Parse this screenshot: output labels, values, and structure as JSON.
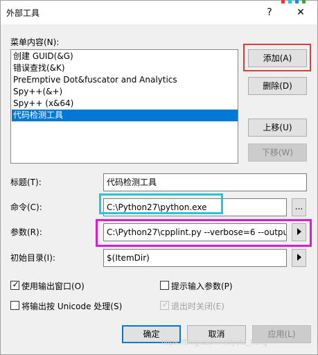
{
  "window": {
    "title": "外部工具",
    "help_glyph": "?",
    "close_glyph": "✕"
  },
  "menu": {
    "label": "菜单内容(N):",
    "items": [
      "创建 GUID(&G)",
      "错误查找(&K)",
      "PreEmptive Dot&fuscator and Analytics",
      "Spy++(&+)",
      "Spy++ (x&64)",
      "代码检测工具"
    ],
    "selected_index": 5
  },
  "buttons": {
    "add": "添加(A)",
    "delete": "删除(D)",
    "move_up": "上移(U)",
    "move_down": "下移(W)",
    "ok": "确定",
    "cancel": "取消",
    "apply": "应用(L)"
  },
  "fields": {
    "title_label": "标题(T):",
    "title_value": "代码检测工具",
    "command_label": "命令(C):",
    "command_value": "C:\\Python27\\python.exe",
    "browse_glyph": "...",
    "args_label": "参数(R):",
    "args_value": "C:\\Python27\\cpplint.py --verbose=6 --outpu",
    "initdir_label": "初始目录(I):",
    "initdir_value": "$(ItemDir)"
  },
  "options": {
    "use_output_window": {
      "label": "使用输出窗口(O)",
      "checked": true
    },
    "prompt_args": {
      "label": "提示输入参数(P)",
      "checked": false
    },
    "unicode_output": {
      "label": "将输出按 Unicode 处理(S)",
      "checked": false
    },
    "close_on_exit": {
      "label": "退出时关闭(E)",
      "checked": true,
      "disabled": true
    }
  },
  "watermark": "https://blog.csdn.net/yetu_hong",
  "colors": {
    "highlight_add": "#e53935",
    "highlight_command": "#26c6da",
    "highlight_args": "#d81bd8",
    "selection": "#0078d7"
  }
}
